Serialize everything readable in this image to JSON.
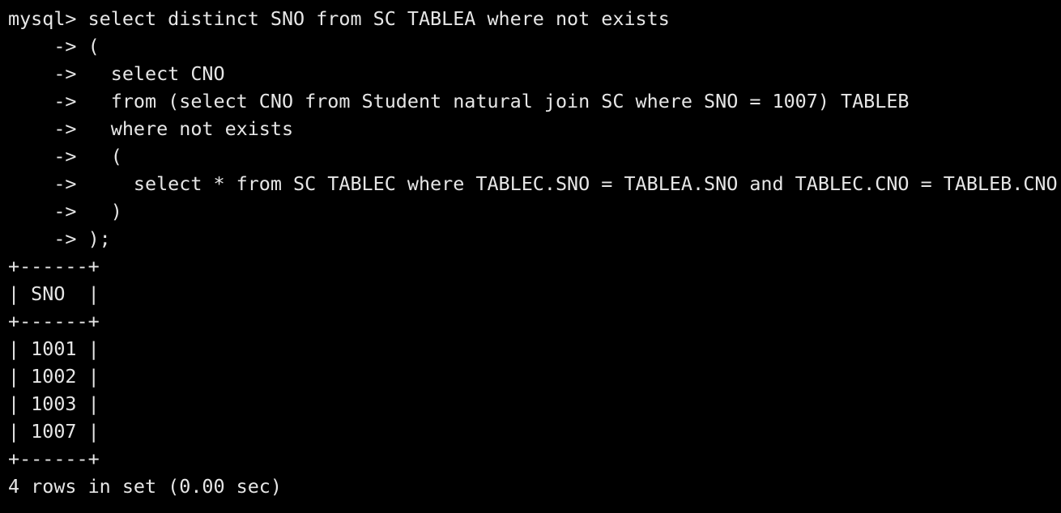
{
  "terminal": {
    "lines": [
      "mysql> select distinct SNO from SC TABLEA where not exists",
      "    -> (",
      "    ->   select CNO",
      "    ->   from (select CNO from Student natural join SC where SNO = 1007) TABLEB",
      "    ->   where not exists",
      "    ->   (",
      "    ->     select * from SC TABLEC where TABLEC.SNO = TABLEA.SNO and TABLEC.CNO = TABLEB.CNO",
      "    ->   )",
      "    -> );",
      "+------+",
      "| SNO  |",
      "+------+",
      "| 1001 |",
      "| 1002 |",
      "| 1003 |",
      "| 1007 |",
      "+------+",
      "4 rows in set (0.00 sec)"
    ]
  }
}
